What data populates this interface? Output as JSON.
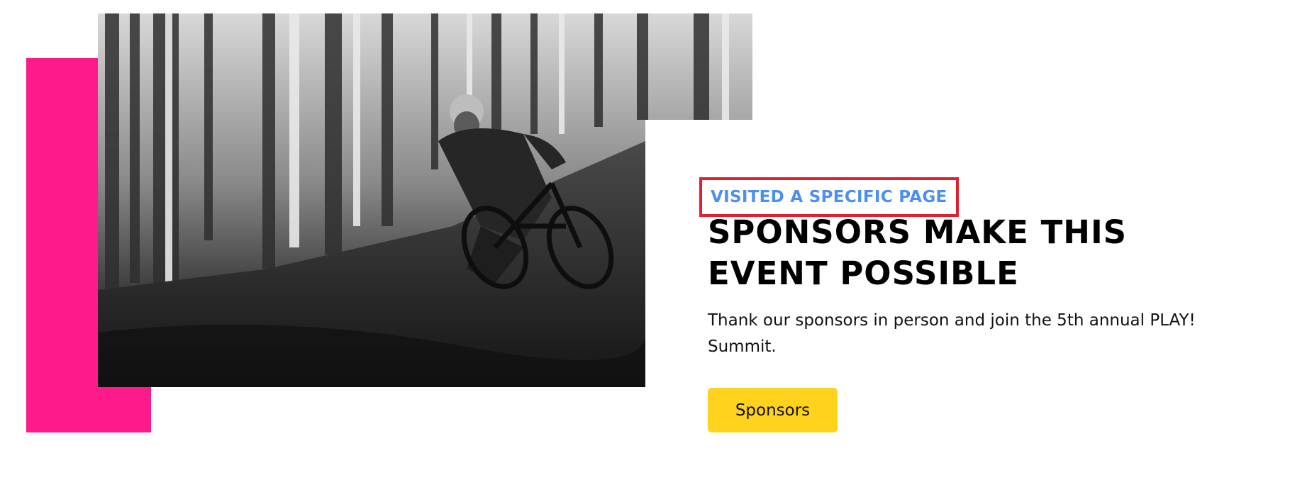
{
  "section": {
    "eyebrow": "VISITED A SPECIFIC PAGE",
    "headline": "SPONSORS MAKE THIS EVENT POSSIBLE",
    "body": "Thank our sponsors in person and join the 5th annual PLAY! Summit.",
    "cta_label": "Sponsors"
  },
  "image": {
    "subject": "black-and-white photo of mountain biker riding a forest trail"
  },
  "colors": {
    "accent_pink": "#ff1a8c",
    "eyebrow_blue": "#4d8ff0",
    "highlight_red": "#e0202e",
    "cta_yellow": "#ffd21e",
    "text_dark": "#000000"
  }
}
